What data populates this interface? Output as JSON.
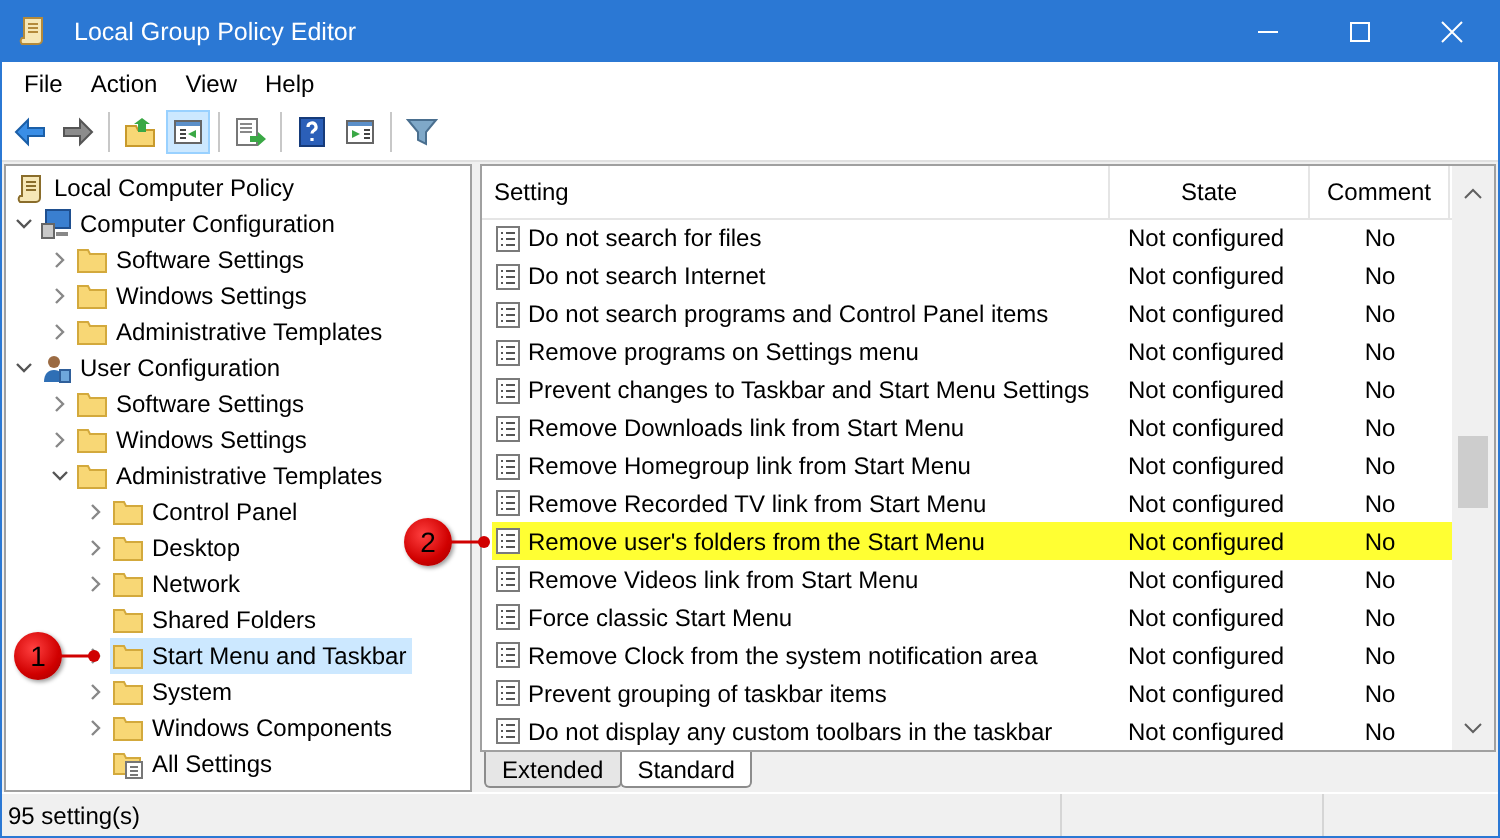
{
  "window": {
    "title": "Local Group Policy Editor"
  },
  "menu": [
    "File",
    "Action",
    "View",
    "Help"
  ],
  "toolbar": [
    {
      "kind": "back",
      "pressed": false
    },
    {
      "kind": "forward",
      "pressed": false
    },
    {
      "kind": "separator"
    },
    {
      "kind": "up",
      "pressed": false
    },
    {
      "kind": "tree",
      "pressed": true
    },
    {
      "kind": "separator"
    },
    {
      "kind": "export",
      "pressed": false
    },
    {
      "kind": "separator"
    },
    {
      "kind": "help",
      "pressed": false
    },
    {
      "kind": "pane",
      "pressed": false
    },
    {
      "kind": "separator"
    },
    {
      "kind": "filter",
      "pressed": false
    }
  ],
  "tree": {
    "items": [
      {
        "label": "Local Computer Policy",
        "kind": "policy",
        "selected": false,
        "children": [
          {
            "label": "Computer Configuration",
            "kind": "computer",
            "expanded": true,
            "selected": false,
            "children": [
              {
                "label": "Software Settings",
                "kind": "folder",
                "expanded": false,
                "selected": false
              },
              {
                "label": "Windows Settings",
                "kind": "folder",
                "expanded": false,
                "selected": false
              },
              {
                "label": "Administrative Templates",
                "kind": "folder",
                "expanded": false,
                "selected": false
              }
            ]
          },
          {
            "label": "User Configuration",
            "kind": "user",
            "expanded": true,
            "selected": false,
            "children": [
              {
                "label": "Software Settings",
                "kind": "folder",
                "expanded": false,
                "selected": false
              },
              {
                "label": "Windows Settings",
                "kind": "folder",
                "expanded": false,
                "selected": false
              },
              {
                "label": "Administrative Templates",
                "kind": "folder",
                "expanded": true,
                "selected": false,
                "children": [
                  {
                    "label": "Control Panel",
                    "kind": "folder",
                    "expanded": false,
                    "selected": false
                  },
                  {
                    "label": "Desktop",
                    "kind": "folder",
                    "expanded": false,
                    "selected": false
                  },
                  {
                    "label": "Network",
                    "kind": "folder",
                    "expanded": false,
                    "selected": false
                  },
                  {
                    "label": "Shared Folders",
                    "kind": "folder",
                    "selected": false
                  },
                  {
                    "label": "Start Menu and Taskbar",
                    "kind": "folder",
                    "expanded": false,
                    "selected": true,
                    "callout": "1"
                  },
                  {
                    "label": "System",
                    "kind": "folder",
                    "expanded": false,
                    "selected": false
                  },
                  {
                    "label": "Windows Components",
                    "kind": "folder",
                    "expanded": false,
                    "selected": false
                  },
                  {
                    "label": "All Settings",
                    "kind": "allsettings",
                    "selected": false
                  }
                ]
              }
            ]
          }
        ]
      }
    ]
  },
  "list": {
    "columns": [
      "Setting",
      "State",
      "Comment"
    ],
    "rows": [
      {
        "setting": "Do not search for files",
        "state": "Not configured",
        "comment": "No",
        "highlighted": false
      },
      {
        "setting": "Do not search Internet",
        "state": "Not configured",
        "comment": "No",
        "highlighted": false
      },
      {
        "setting": "Do not search programs and Control Panel items",
        "state": "Not configured",
        "comment": "No",
        "highlighted": false
      },
      {
        "setting": "Remove programs on Settings menu",
        "state": "Not configured",
        "comment": "No",
        "highlighted": false
      },
      {
        "setting": "Prevent changes to Taskbar and Start Menu Settings",
        "state": "Not configured",
        "comment": "No",
        "highlighted": false
      },
      {
        "setting": "Remove Downloads link from Start Menu",
        "state": "Not configured",
        "comment": "No",
        "highlighted": false
      },
      {
        "setting": "Remove Homegroup link from Start Menu",
        "state": "Not configured",
        "comment": "No",
        "highlighted": false
      },
      {
        "setting": "Remove Recorded TV link from Start Menu",
        "state": "Not configured",
        "comment": "No",
        "highlighted": false
      },
      {
        "setting": "Remove user's folders from the Start Menu",
        "state": "Not configured",
        "comment": "No",
        "highlighted": true,
        "callout": "2"
      },
      {
        "setting": "Remove Videos link from Start Menu",
        "state": "Not configured",
        "comment": "No",
        "highlighted": false
      },
      {
        "setting": "Force classic Start Menu",
        "state": "Not configured",
        "comment": "No",
        "highlighted": false
      },
      {
        "setting": "Remove Clock from the system notification area",
        "state": "Not configured",
        "comment": "No",
        "highlighted": false
      },
      {
        "setting": "Prevent grouping of taskbar items",
        "state": "Not configured",
        "comment": "No",
        "highlighted": false
      },
      {
        "setting": "Do not display any custom toolbars in the taskbar",
        "state": "Not configured",
        "comment": "No",
        "highlighted": false
      }
    ]
  },
  "tabs": [
    {
      "label": "Extended",
      "selected": false
    },
    {
      "label": "Standard",
      "selected": true
    }
  ],
  "status_bar": {
    "text": "95 setting(s)"
  }
}
